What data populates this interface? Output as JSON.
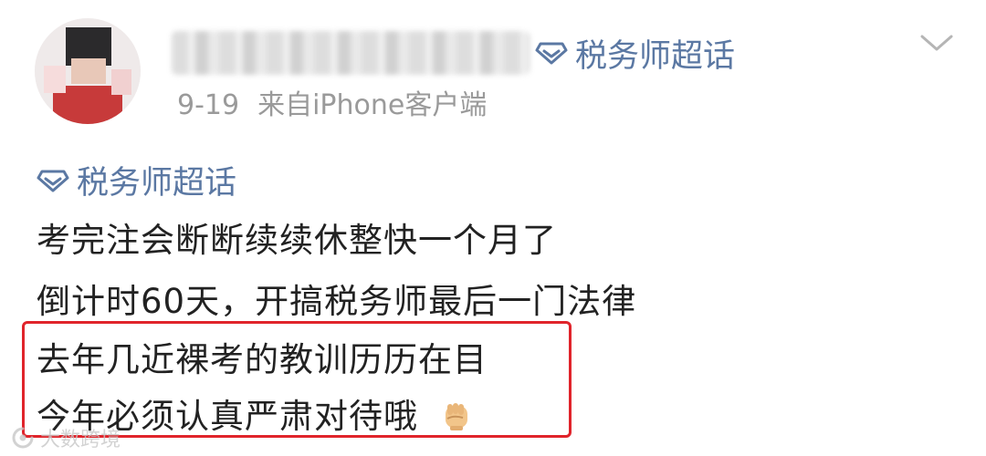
{
  "post": {
    "supertopic_header": "税务师超话",
    "timestamp": "9-19",
    "source": "来自iPhone客户端",
    "topic_tag": "税务师超话",
    "lines": [
      "考完注会断断续续休整快一个月了",
      "倒计时60天，开搞税务师最后一门法律",
      "去年几近裸考的教训历历在目",
      "今年必须认真严肃对待哦"
    ],
    "emoji": "fist-emoji"
  },
  "watermark": {
    "text": "大数跨境"
  },
  "colors": {
    "link": "#5b78a3",
    "meta": "#9a9a9a",
    "body": "#222222",
    "highlight_border": "#e0242b"
  }
}
